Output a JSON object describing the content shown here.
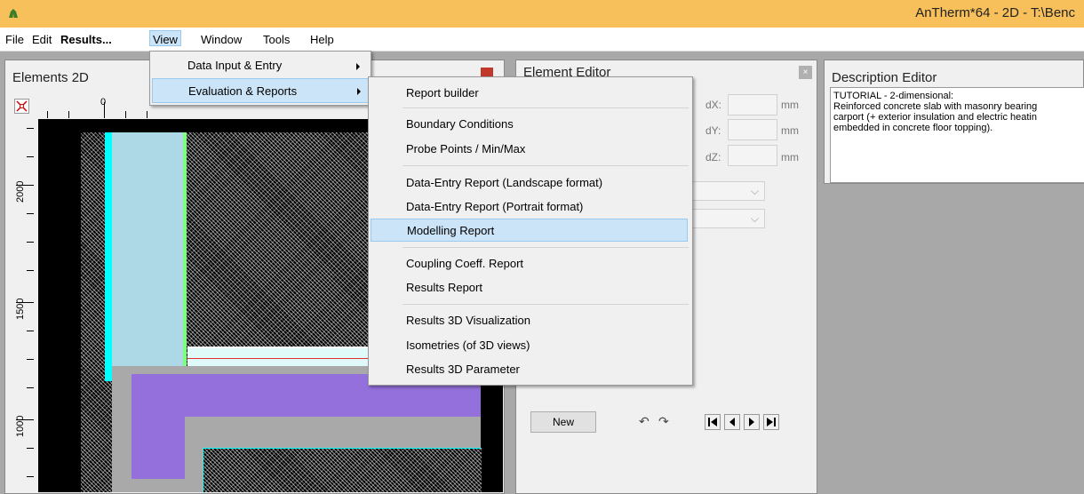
{
  "window": {
    "title": "AnTherm*64 - 2D - T:\\Benc"
  },
  "menubar": {
    "file": "File",
    "edit": "Edit",
    "results": "Results...",
    "view": "View",
    "window": "Window",
    "tools": "Tools",
    "help": "Help"
  },
  "view_menu": {
    "items": [
      "Data Input & Entry",
      "Evaluation & Reports"
    ]
  },
  "reports_menu": {
    "items": [
      "Report builder",
      "Boundary Conditions",
      "Probe Points / Min/Max",
      "Data-Entry Report (Landscape format)",
      "Data-Entry Report (Portrait format)",
      "Modelling Report",
      "Coupling Coeff. Report",
      "Results Report",
      "Results 3D Visualization",
      "Isometries (of 3D views)",
      "Results 3D Parameter"
    ],
    "highlighted": "Modelling Report"
  },
  "elements_panel": {
    "title": "Elements 2D",
    "ruler_top": [
      "0"
    ],
    "ruler_left": [
      "2000",
      "1500",
      "1000"
    ]
  },
  "element_editor": {
    "title": "Element Editor",
    "dx_label": "dX:",
    "dy_label": "dY:",
    "dz_label": "dZ:",
    "unit": "mm",
    "new_button": "New"
  },
  "description_editor": {
    "title": "Description Editor",
    "text": "TUTORIAL - 2-dimensional:\nReinforced concrete slab with masonry bearing\ncarport (+ exterior insulation and electric heatin\nembedded in concrete floor topping)."
  },
  "colors": {
    "titlebar": "#f7c05a",
    "menu_highlight": "#cce4f7",
    "purple_element": "#9370db",
    "lightblue_element": "#add8e6",
    "cyan_element": "#00ffff",
    "grey_element": "#a9a9a9"
  }
}
